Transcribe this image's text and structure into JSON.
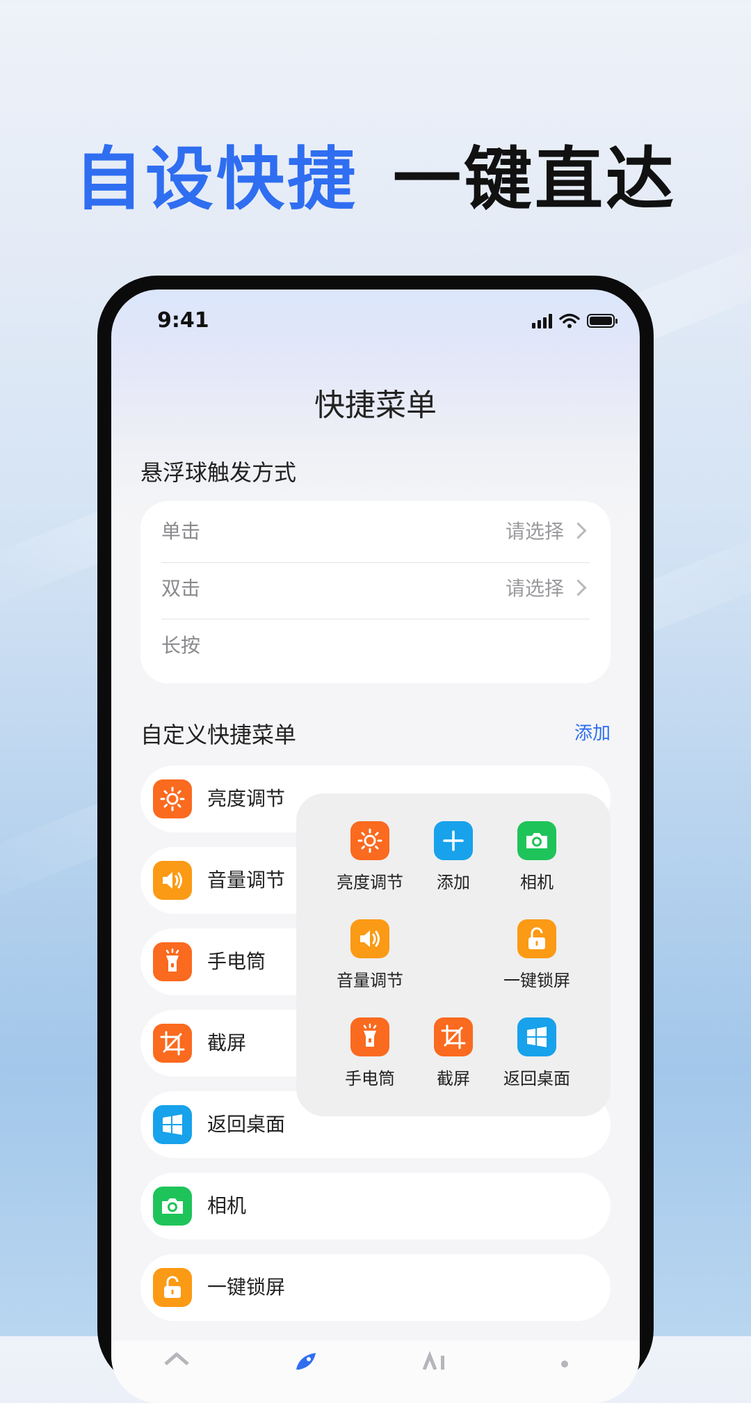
{
  "banner": {
    "highlight": "自设快捷",
    "rest": "一键直达"
  },
  "status_bar": {
    "time": "9:41"
  },
  "page_title": "快捷菜单",
  "trigger_section": {
    "title": "悬浮球触发方式",
    "rows": [
      {
        "label": "单击",
        "value": "请选择"
      },
      {
        "label": "双击",
        "value": "请选择"
      },
      {
        "label": "长按",
        "value": ""
      }
    ]
  },
  "custom_section": {
    "title": "自定义快捷菜单",
    "add_label": "添加",
    "items": [
      {
        "label": "亮度调节",
        "icon": "sun-icon",
        "color": "#fa6a1f"
      },
      {
        "label": "音量调节",
        "icon": "speaker-icon",
        "color": "#fb9a14"
      },
      {
        "label": "手电筒",
        "icon": "flashlight-icon",
        "color": "#fa6a1f"
      },
      {
        "label": "截屏",
        "icon": "crop-icon",
        "color": "#fa6a1f"
      },
      {
        "label": "返回桌面",
        "icon": "windows-icon",
        "color": "#17a2eb"
      },
      {
        "label": "相机",
        "icon": "camera-icon",
        "color": "#1ec459"
      },
      {
        "label": "一键锁屏",
        "icon": "unlock-icon",
        "color": "#fb9a14"
      }
    ]
  },
  "popup_menu": {
    "items": [
      {
        "label": "亮度调节",
        "icon": "sun-icon"
      },
      {
        "label": "添加",
        "icon": "plus-icon"
      },
      {
        "label": "相机",
        "icon": "camera-icon"
      },
      {
        "label": "音量调节",
        "icon": "speaker-icon"
      },
      {
        "label": "一键锁屏",
        "icon": "unlock-icon"
      },
      {
        "label": "手电筒",
        "icon": "flashlight-icon"
      },
      {
        "label": "截屏",
        "icon": "crop-icon"
      },
      {
        "label": "返回桌面",
        "icon": "windows-icon"
      }
    ]
  },
  "tab_bar": {
    "icons": [
      "home-icon",
      "rocket-icon",
      "ai-icon",
      "profile-icon"
    ]
  }
}
